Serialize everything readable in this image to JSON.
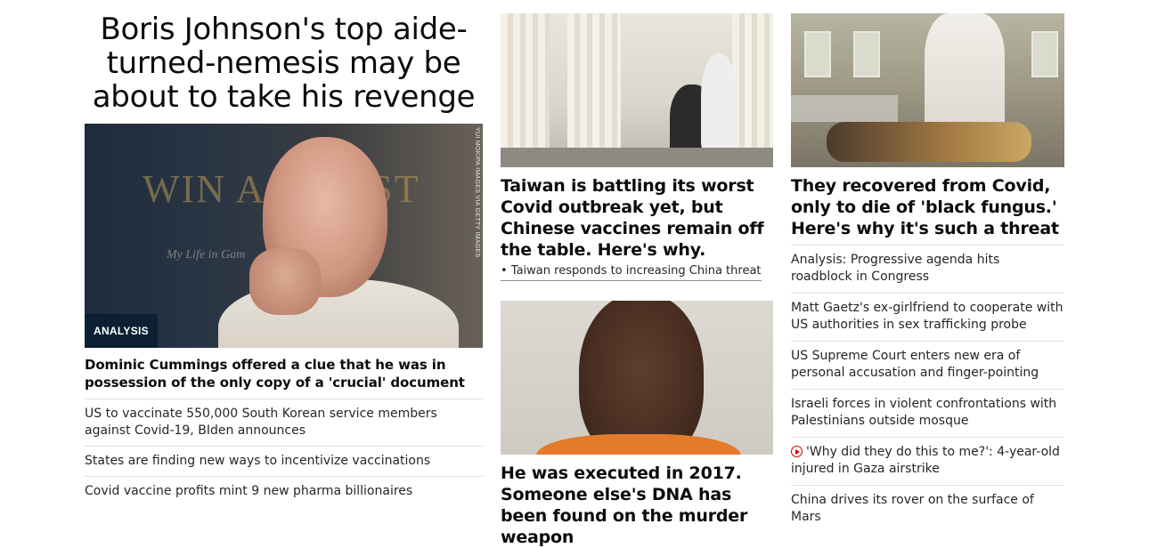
{
  "col1": {
    "headline": "Boris Johnson's top aide-turned-nemesis may be about to take his revenge",
    "image": {
      "badge": "ANALYSIS",
      "credit": "YUI MOK/PA IMAGES VIA GETTY IMAGES",
      "book_text": "WIN AGAINST",
      "book_subtext": "My Life in Gam"
    },
    "caption": "Dominic Cummings offered a clue that he was in possession of the only copy of a 'crucial' document",
    "links": [
      "US to vaccinate 550,000 South Korean service members against Covid-19, BIden announces",
      "States are finding new ways to incentivize vaccinations",
      "Covid vaccine profits mint 9 new pharma billionaires"
    ]
  },
  "col2": {
    "story1": {
      "title": "Taiwan is battling its worst Covid outbreak yet, but Chinese vaccines remain off the table. Here's why.",
      "sub_link": "• Taiwan responds to increasing China threat"
    },
    "story2": {
      "title": "He was executed in 2017. Someone else's DNA has been found on the murder weapon"
    }
  },
  "col3": {
    "story": {
      "title": "They recovered from Covid, only to die of 'black fungus.' Here's why it's such a threat"
    },
    "links": [
      {
        "text": "Analysis: Progressive agenda hits roadblock in Congress",
        "icon": ""
      },
      {
        "text": "Matt Gaetz's ex-girlfriend to cooperate with US authorities in sex trafficking probe",
        "icon": ""
      },
      {
        "text": "US Supreme Court enters new era of personal accusation and finger-pointing",
        "icon": ""
      },
      {
        "text": "Israeli forces in violent confrontations with Palestinians outside mosque",
        "icon": ""
      },
      {
        "text": "'Why did they do this to me?': 4-year-old injured in Gaza airstrike",
        "icon": "play-icon"
      },
      {
        "text": "China drives its rover on the surface of Mars",
        "icon": ""
      }
    ]
  },
  "colors": {
    "text": "#0c0c0c",
    "badge_bg": "#0c1f33",
    "divider": "#dedede",
    "video_icon": "#cc0000"
  }
}
